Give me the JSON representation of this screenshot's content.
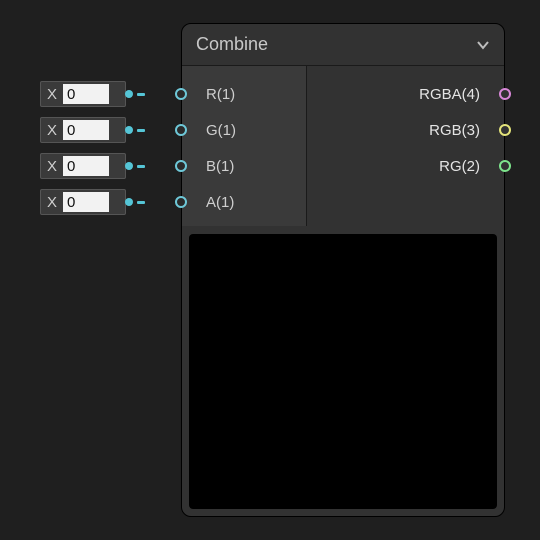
{
  "node": {
    "title": "Combine",
    "inputs": [
      {
        "label": "R(1)",
        "port_color": "#6ec8d8"
      },
      {
        "label": "G(1)",
        "port_color": "#6ec8d8"
      },
      {
        "label": "B(1)",
        "port_color": "#6ec8d8"
      },
      {
        "label": "A(1)",
        "port_color": "#6ec8d8"
      }
    ],
    "outputs": [
      {
        "label": "RGBA(4)",
        "port_color": "#d887d8"
      },
      {
        "label": "RGB(3)",
        "port_color": "#e4e47a"
      },
      {
        "label": "RG(2)",
        "port_color": "#7de48c"
      }
    ]
  },
  "value_nodes": [
    {
      "x_label": "X",
      "value": "0"
    },
    {
      "x_label": "X",
      "value": "0"
    },
    {
      "x_label": "X",
      "value": "0"
    },
    {
      "x_label": "X",
      "value": "0"
    }
  ]
}
